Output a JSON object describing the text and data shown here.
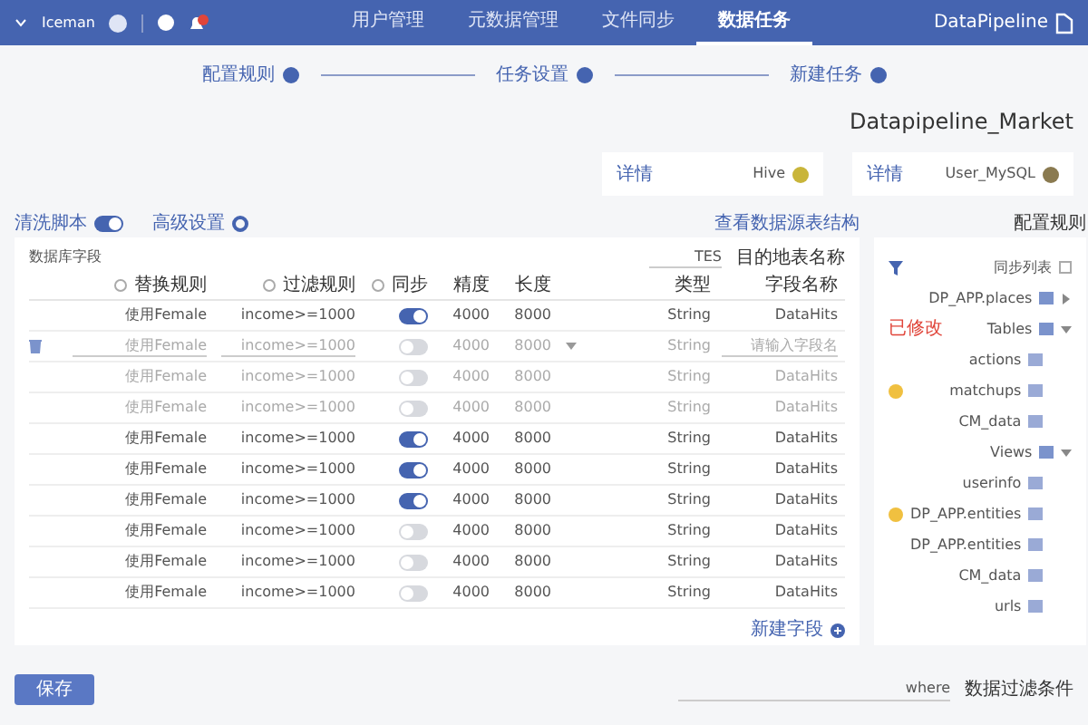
{
  "nav": {
    "logo": "DataPipeline",
    "user": "Iceman",
    "tabs": [
      {
        "label": "用户管理",
        "selected": false
      },
      {
        "label": "元数据管理",
        "selected": false
      },
      {
        "label": "文件同步",
        "selected": false
      },
      {
        "label": "数据任务",
        "selected": true
      }
    ]
  },
  "steps": [
    "配置规则",
    "任务设置",
    "新建任务"
  ],
  "title": "Datapipeline_Market",
  "sources": [
    {
      "name": "Hive",
      "link": "详情"
    },
    {
      "name": "User_MySQL",
      "link": "详情"
    }
  ],
  "tree": {
    "heading": "配置规则",
    "header": "同步列表",
    "items": [
      {
        "label": "DP_APP.places",
        "expanded": false
      },
      {
        "label": "Tables",
        "expanded": true,
        "tag": "已修改",
        "children": [
          {
            "label": "actions",
            "warning": false
          },
          {
            "label": "matchups",
            "warning": true
          },
          {
            "label": "CM_data",
            "warning": false
          }
        ]
      },
      {
        "label": "Views",
        "expanded": true,
        "children": [
          {
            "label": "userinfo",
            "warning": false
          },
          {
            "label": "DP_APP.entities",
            "warning": true
          },
          {
            "label": "DP_APP.entities",
            "warning": false
          },
          {
            "label": "CM_data",
            "warning": false
          },
          {
            "label": "urls",
            "warning": false
          }
        ]
      }
    ]
  },
  "rules": {
    "script": {
      "label": "清洗脚本",
      "on": true
    },
    "advanced": "高级设置",
    "schema_link": "查看数据源表结构",
    "caption": "数据库字段",
    "dest_value": "TES",
    "dest_label": "目的地表名称",
    "columns": [
      "替换规则",
      "过滤规则",
      "同步",
      "精度",
      "长度",
      "类型",
      "字段名称"
    ],
    "rows": [
      {
        "kind": "field",
        "replace": "使用Female",
        "filter": "income>=1000",
        "sync": true,
        "disabled": false,
        "precision": "4000",
        "length": "8000",
        "type": "String",
        "name": "DataHits"
      },
      {
        "kind": "edit",
        "replace": "使用Female",
        "filter": "income>=1000",
        "sync": false,
        "disabled": true,
        "precision": "4000",
        "length": "8000",
        "type": "String",
        "placeholder": "请输入字段名"
      },
      {
        "kind": "field",
        "replace": "使用Female",
        "filter": "income>=1000",
        "sync": false,
        "disabled": true,
        "precision": "4000",
        "length": "8000",
        "type": "String",
        "name": "DataHits"
      },
      {
        "kind": "field",
        "replace": "使用Female",
        "filter": "income>=1000",
        "sync": false,
        "disabled": true,
        "precision": "4000",
        "length": "8000",
        "type": "String",
        "name": "DataHits"
      },
      {
        "kind": "field",
        "replace": "使用Female",
        "filter": "income>=1000",
        "sync": true,
        "disabled": false,
        "precision": "4000",
        "length": "8000",
        "type": "String",
        "name": "DataHits"
      },
      {
        "kind": "field",
        "replace": "使用Female",
        "filter": "income>=1000",
        "sync": true,
        "disabled": false,
        "precision": "4000",
        "length": "8000",
        "type": "String",
        "name": "DataHits"
      },
      {
        "kind": "field",
        "replace": "使用Female",
        "filter": "income>=1000",
        "sync": true,
        "disabled": false,
        "precision": "4000",
        "length": "8000",
        "type": "String",
        "name": "DataHits"
      },
      {
        "kind": "field",
        "replace": "使用Female",
        "filter": "income>=1000",
        "sync": false,
        "disabled": false,
        "precision": "4000",
        "length": "8000",
        "type": "String",
        "name": "DataHits"
      },
      {
        "kind": "field",
        "replace": "使用Female",
        "filter": "income>=1000",
        "sync": false,
        "disabled": false,
        "precision": "4000",
        "length": "8000",
        "type": "String",
        "name": "DataHits"
      },
      {
        "kind": "field",
        "replace": "使用Female",
        "filter": "income>=1000",
        "sync": false,
        "disabled": false,
        "precision": "4000",
        "length": "8000",
        "type": "String",
        "name": "DataHits"
      }
    ],
    "add": "新建字段",
    "save": "保存",
    "filter_value": "where",
    "filter_label": "数据过滤条件"
  }
}
